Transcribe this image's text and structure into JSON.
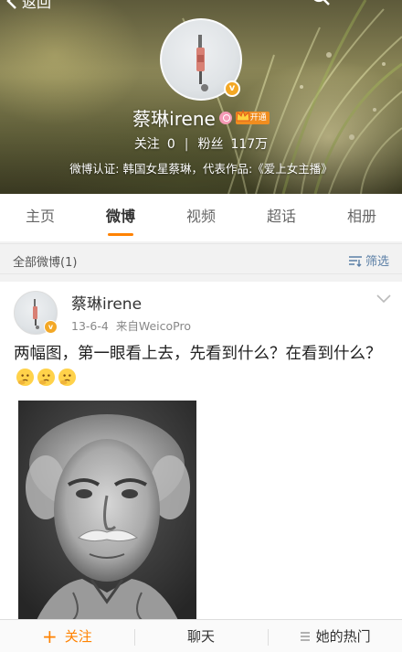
{
  "header": {
    "back_label": "返回",
    "back_icon": "chevron-left-icon",
    "search_icon": "search-icon"
  },
  "profile": {
    "name": "蔡琳irene",
    "vip_label": "开通",
    "follow_label": "关注",
    "follow_count": "0",
    "fans_label": "粉丝",
    "fans_count": "117万",
    "verification": "微博认证: 韩国女星蔡琳，代表作品:《爱上女主播》",
    "verified_badge": "v"
  },
  "tabs": [
    {
      "label": "主页",
      "active": false
    },
    {
      "label": "微博",
      "active": true
    },
    {
      "label": "视频",
      "active": false
    },
    {
      "label": "超话",
      "active": false
    },
    {
      "label": "相册",
      "active": false
    }
  ],
  "filter_bar": {
    "all_posts_label": "全部微博(1)",
    "filter_label": "筛选"
  },
  "post": {
    "author": "蔡琳irene",
    "date": "13-6-4",
    "source": "来自WeicoPro",
    "text": "两幅图，第一眼看上去，先看到什么？在看到什么？",
    "emoji_count": 3
  },
  "bottom_bar": {
    "follow_label": "关注",
    "follow_plus": "+",
    "chat_label": "聊天",
    "hot_label": "她的热门"
  },
  "colors": {
    "accent": "#ff8200",
    "link": "#5b7fa6",
    "verified": "#f3a826"
  }
}
